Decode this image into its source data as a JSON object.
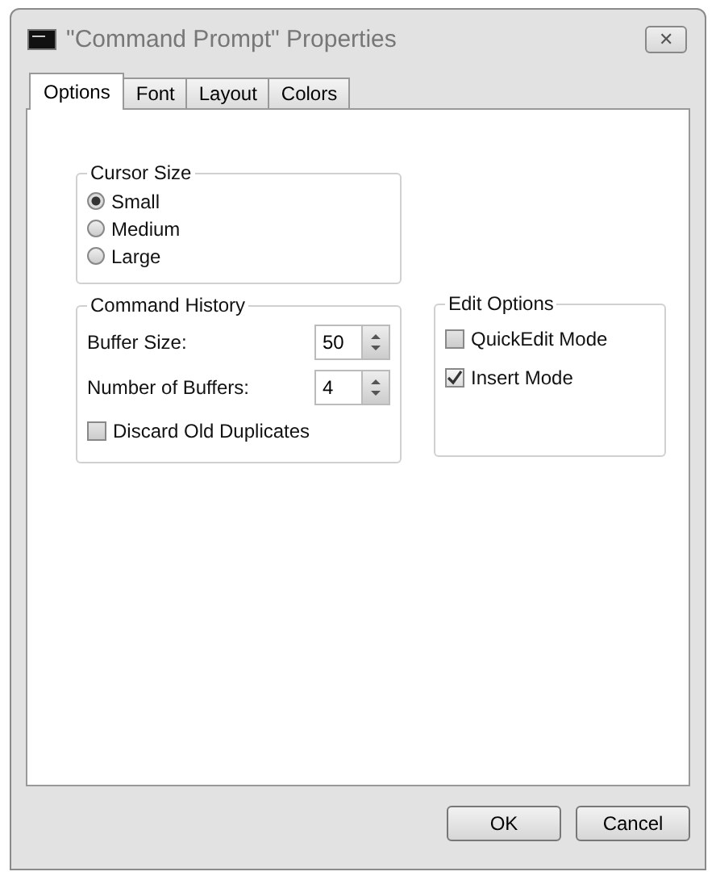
{
  "window": {
    "title": "\"Command Prompt\" Properties",
    "close": "✕"
  },
  "tabs": [
    {
      "label": "Options",
      "selected": true
    },
    {
      "label": "Font",
      "selected": false
    },
    {
      "label": "Layout",
      "selected": false
    },
    {
      "label": "Colors",
      "selected": false
    }
  ],
  "cursor_size": {
    "title": "Cursor Size",
    "options": [
      {
        "label": "Small",
        "selected": true
      },
      {
        "label": "Medium",
        "selected": false
      },
      {
        "label": "Large",
        "selected": false
      }
    ]
  },
  "command_history": {
    "title": "Command History",
    "fields": [
      {
        "label": "Buffer Size:",
        "value": "50"
      },
      {
        "label": "Number of Buffers:",
        "value": "4"
      }
    ],
    "discard_old_duplicates": {
      "label": "Discard Old Duplicates",
      "checked": false
    }
  },
  "edit_options": {
    "title": "Edit Options",
    "options": [
      {
        "label": "QuickEdit Mode",
        "checked": false
      },
      {
        "label": "Insert Mode",
        "checked": true
      }
    ]
  },
  "buttons": [
    "OK",
    "Cancel"
  ]
}
